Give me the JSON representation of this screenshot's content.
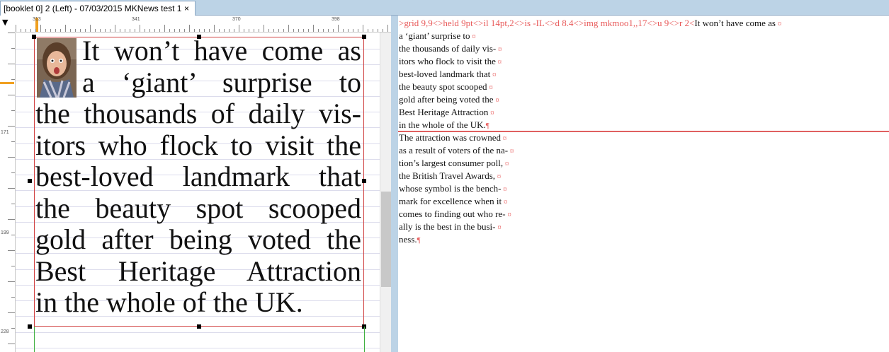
{
  "tab": {
    "title": "[booklet 0] 2 (Left) - 07/03/2015 MKNews test 1",
    "close": "×"
  },
  "ruler": {
    "h_labels": [
      "313",
      "341",
      "370",
      "398"
    ],
    "v_labels": [
      "171",
      "199",
      "228"
    ],
    "corner": "▼"
  },
  "story": {
    "lines": [
      "It won’t have come as",
      "a ‘giant’ surprise to",
      "the thousands of daily vis-",
      "itors who flock to visit the",
      "best-loved landmark that",
      "the beauty spot scooped",
      "gold after being voted the",
      "Best Heritage Attraction",
      "in the whole of the UK."
    ]
  },
  "code": {
    "tags_line": ">grid 9,9<>held 9pt<>il 14pt,2<>is -IL<>d 8.4<>img mkmoo1,,17<>u 9<>r 2<",
    "para1": [
      "It won’t have come as",
      "a ‘giant’ surprise to",
      "the thousands of daily vis-",
      "itors who flock to visit the",
      "best-loved landmark that",
      "the beauty spot scooped",
      "gold after being voted the",
      "Best Heritage Attraction",
      "in the whole of the UK."
    ],
    "para2": [
      "The attraction was crowned",
      "as a result of voters of the na-",
      "tion’s largest consumer poll,",
      "the British Travel Awards,",
      "whose symbol is the bench-",
      "mark for excellence when it",
      "comes to finding out who re-",
      "ally is the best in the busi-",
      "ness."
    ],
    "line_mark": "¤",
    "para_mark": "¶"
  },
  "colors": {
    "tag": "#e85a5a",
    "tab_bar": "#bcd3e6",
    "frame": "#d04040"
  }
}
